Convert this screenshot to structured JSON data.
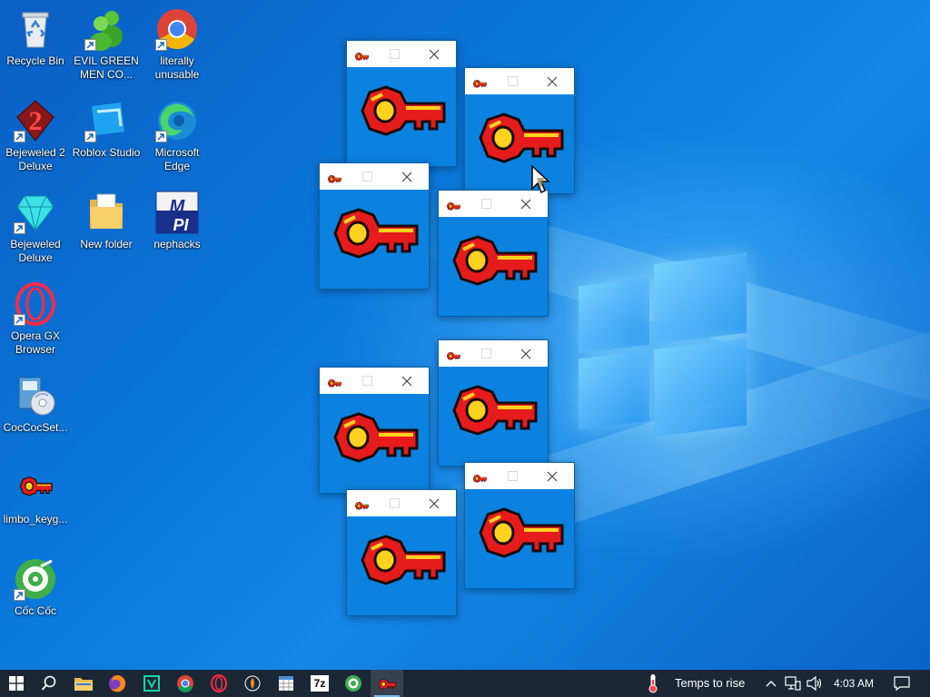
{
  "desktop": {
    "icons": [
      {
        "label": "Recycle Bin",
        "icon": "recycle-bin-icon"
      },
      {
        "label": "EVIL GREEN MEN CO...",
        "icon": "green-men-icon"
      },
      {
        "label": "literally unusable",
        "icon": "chrome-icon"
      },
      {
        "label": "Bejeweled 2 Deluxe",
        "icon": "bejeweled-2-icon"
      },
      {
        "label": "Roblox Studio",
        "icon": "roblox-studio-icon"
      },
      {
        "label": "Microsoft Edge",
        "icon": "edge-icon"
      },
      {
        "label": "Bejeweled Deluxe",
        "icon": "bejeweled-icon"
      },
      {
        "label": "New folder",
        "icon": "folder-icon"
      },
      {
        "label": "nephacks",
        "icon": "mpi-icon"
      },
      {
        "label": "Opera GX Browser",
        "icon": "opera-gx-icon"
      },
      {
        "label": "CocCocSet...",
        "icon": "installer-icon"
      },
      {
        "label": "limbo_keyg...",
        "icon": "key-icon"
      },
      {
        "label": "Cốc Cốc",
        "icon": "coccoc-icon"
      }
    ]
  },
  "keygen_windows": {
    "count": 8,
    "titlebar_icon": "key-icon",
    "content_icon": "key-icon",
    "controls": [
      "maximize-button",
      "close-button"
    ]
  },
  "taskbar": {
    "apps": [
      {
        "name": "file-explorer",
        "icon": "folder-icon"
      },
      {
        "name": "firefox",
        "icon": "firefox-icon"
      },
      {
        "name": "roblox-studio",
        "icon": "roblox-studio-icon"
      },
      {
        "name": "chrome",
        "icon": "chrome-icon"
      },
      {
        "name": "opera-gx",
        "icon": "opera-gx-icon"
      },
      {
        "name": "app-orange",
        "icon": "app-icon"
      },
      {
        "name": "app-calendar",
        "icon": "grid-app-icon"
      },
      {
        "name": "7zip",
        "icon": "7zip-icon",
        "text": "7z"
      },
      {
        "name": "coccoc",
        "icon": "coccoc-icon"
      },
      {
        "name": "limbo-keygen",
        "icon": "key-icon",
        "active": true
      }
    ],
    "weather_text": "Temps to rise",
    "time": "4:03 AM"
  },
  "colors": {
    "desktop_blue": "#0b78db",
    "window_blue": "#0b82e0",
    "key_red": "#e61c1c",
    "key_yellow": "#ffd21f",
    "taskbar": "#1b2735"
  }
}
